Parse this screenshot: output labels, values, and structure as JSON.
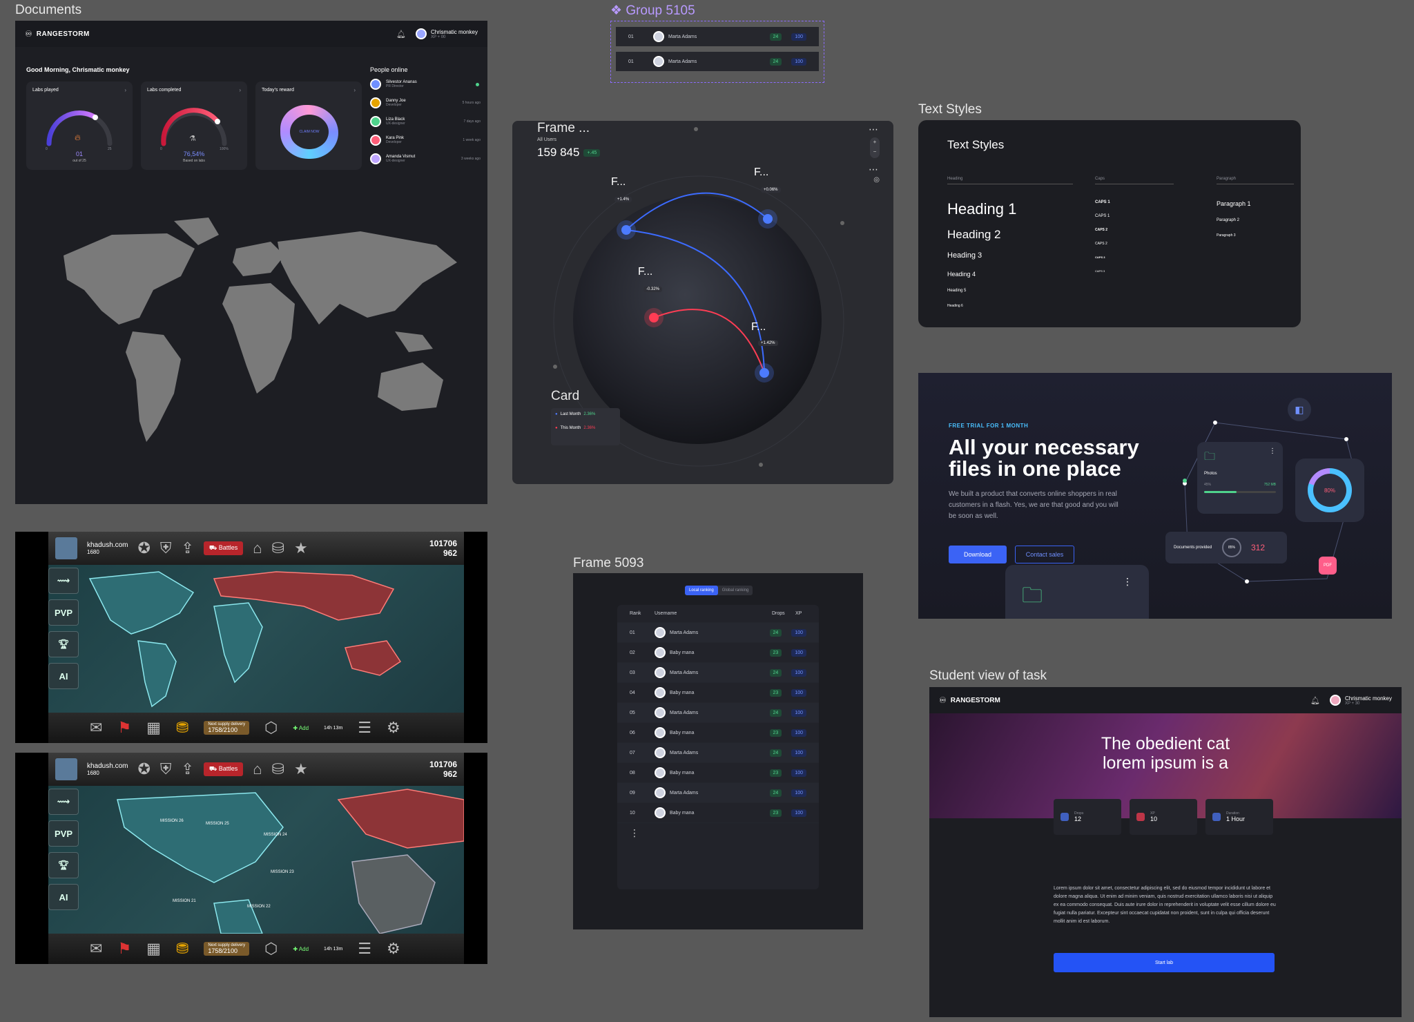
{
  "labels": {
    "documents": "Documents",
    "group": "Group 5105",
    "frame_globe": "Frame ...",
    "text_styles": "Text Styles",
    "frame_table": "Frame 5093",
    "student_view": "Student view of task"
  },
  "dashboard": {
    "brand": "RANGESTORM",
    "user_name": "Chrismatic monkey",
    "user_sub": "XP + 00",
    "greeting": "Good Morning, Chrismatic monkey",
    "cards": [
      {
        "title": "Labs played",
        "value": "01",
        "sub": "out of 25",
        "min": "0",
        "max": "25"
      },
      {
        "title": "Labs completed",
        "value": "76,54%",
        "sub": "Based on labs",
        "min": "0",
        "max": "100%"
      },
      {
        "title": "Today's reward",
        "cta": "CLAIM NOW"
      }
    ],
    "people_title": "People online",
    "people": [
      {
        "name": "Silvestor Ananas",
        "role": "PR Director",
        "time": ""
      },
      {
        "name": "Danny Joe",
        "role": "Developer",
        "time": "5 hours ago"
      },
      {
        "name": "Liza Black",
        "role": "UX-designer",
        "time": "7 days ago"
      },
      {
        "name": "Kara Pink",
        "role": "Developer",
        "time": "1 week ago"
      },
      {
        "name": "Amanda Vismut",
        "role": "UX-designer",
        "time": "3 weeks ago"
      }
    ]
  },
  "group_rows": [
    {
      "rank": "01",
      "name": "Marta Adams",
      "drops": "24",
      "xp": "100"
    },
    {
      "rank": "01",
      "name": "Marta Adams",
      "drops": "24",
      "xp": "100"
    }
  ],
  "globe": {
    "caption": "All Users",
    "total": "159 845",
    "delta": "+.45",
    "markers": [
      {
        "label": "F...",
        "sub": "+1.4%"
      },
      {
        "label": "F...",
        "sub": "+0.06%"
      },
      {
        "label": "F...",
        "sub": "-0.32%"
      },
      {
        "label": "F...",
        "sub": "+1.42%"
      }
    ],
    "card_label": "Card",
    "card_rows": [
      {
        "label": "Last Month",
        "value": "2.36%"
      },
      {
        "label": "This Month",
        "value": "2.36%"
      }
    ]
  },
  "text_styles": {
    "title": "Text Styles",
    "col_heading": "Heading",
    "col_caps": "Caps",
    "col_paragraph": "Paragraph",
    "headings": [
      "Heading 1",
      "Heading 2",
      "Heading 3",
      "Heading 4",
      "Heading 5",
      "Heading 6"
    ],
    "caps": [
      "CAPS 1",
      "CAPS 1",
      "CAPS 2",
      "CAPS 2",
      "CAPS 3",
      "CAPS 3"
    ],
    "paragraphs": [
      "Paragraph 1",
      "Paragraph 2",
      "Paragraph 3"
    ]
  },
  "promo": {
    "eyebrow": "FREE TRIAL FOR 1 MONTH",
    "headline_1": "All your necessary",
    "headline_2": "files in one place",
    "body": "We built a product that converts online shoppers in real customers in a flash. Yes, we are that good and you will be soon as well.",
    "download": "Download",
    "contact": "Contact sales",
    "photos_label": "Photos",
    "photos_size": "752 MB",
    "photos_pct": "45%",
    "docs_label": "Documents provided",
    "docs_pct": "85%",
    "docs_count": "312",
    "donut_value": "80%",
    "pdf": "PDF"
  },
  "ranking": {
    "tab_local": "Local ranking",
    "tab_global": "Global ranking",
    "col_rank": "Rank",
    "col_user": "Username",
    "col_drops": "Drops",
    "col_xp": "XP",
    "rows": [
      {
        "rank": "01",
        "name": "Marta Adams",
        "drops": "24",
        "xp": "100"
      },
      {
        "rank": "02",
        "name": "Baby mana",
        "drops": "23",
        "xp": "100"
      },
      {
        "rank": "03",
        "name": "Marta Adams",
        "drops": "24",
        "xp": "100"
      },
      {
        "rank": "04",
        "name": "Baby mana",
        "drops": "23",
        "xp": "100"
      },
      {
        "rank": "05",
        "name": "Marta Adams",
        "drops": "24",
        "xp": "100"
      },
      {
        "rank": "06",
        "name": "Baby mana",
        "drops": "23",
        "xp": "100"
      },
      {
        "rank": "07",
        "name": "Marta Adams",
        "drops": "24",
        "xp": "100"
      },
      {
        "rank": "08",
        "name": "Baby mana",
        "drops": "23",
        "xp": "100"
      },
      {
        "rank": "09",
        "name": "Marta Adams",
        "drops": "24",
        "xp": "100"
      },
      {
        "rank": "10",
        "name": "Baby mana",
        "drops": "23",
        "xp": "100"
      }
    ]
  },
  "student": {
    "brand": "RANGESTORM",
    "user_name": "Chrismatic monkey",
    "user_sub": "XP + 30",
    "hero_1": "The obedient cat",
    "hero_2": "lorem ipsum is a",
    "stats": [
      {
        "label": "Drops",
        "value": "12"
      },
      {
        "label": "XP",
        "value": "10"
      },
      {
        "label": "Duration",
        "value": "1 Hour"
      }
    ],
    "body": "Lorem ipsum dolor sit amet, consectetur adipiscing elit, sed do eiusmod tempor incididunt ut labore et dolore magna aliqua. Ut enim ad minim veniam, quis nostrud exercitation ullamco laboris nisi ut aliquip ex ea commodo consequat. Duis aute irure dolor in reprehenderit in voluptate velit esse cillum dolore eu fugiat nulla pariatur. Excepteur sint occaecat cupidatat non proident, sunt in culpa qui officia deserunt mollit anim id est laborum.",
    "cta": "Start lab"
  },
  "game": {
    "username": "khadush.com",
    "level": "1680",
    "battles": "Battles",
    "gold": "101706",
    "gems": "962",
    "pvp": "PVP",
    "ai": "AI",
    "supply_label": "Next supply delivery",
    "supply_value": "1758/2100",
    "add": "Add",
    "timer": "14h 13m",
    "missions": [
      "MISSION 26",
      "MISSION 25",
      "MISSION 24",
      "MISSION 23",
      "MISSION 21",
      "MISSION 22"
    ]
  },
  "colors": {
    "accent_blue": "#3b63f5",
    "accent_purple": "#7b5cff",
    "accent_red": "#ff3d54",
    "accent_green": "#4fd38c"
  }
}
